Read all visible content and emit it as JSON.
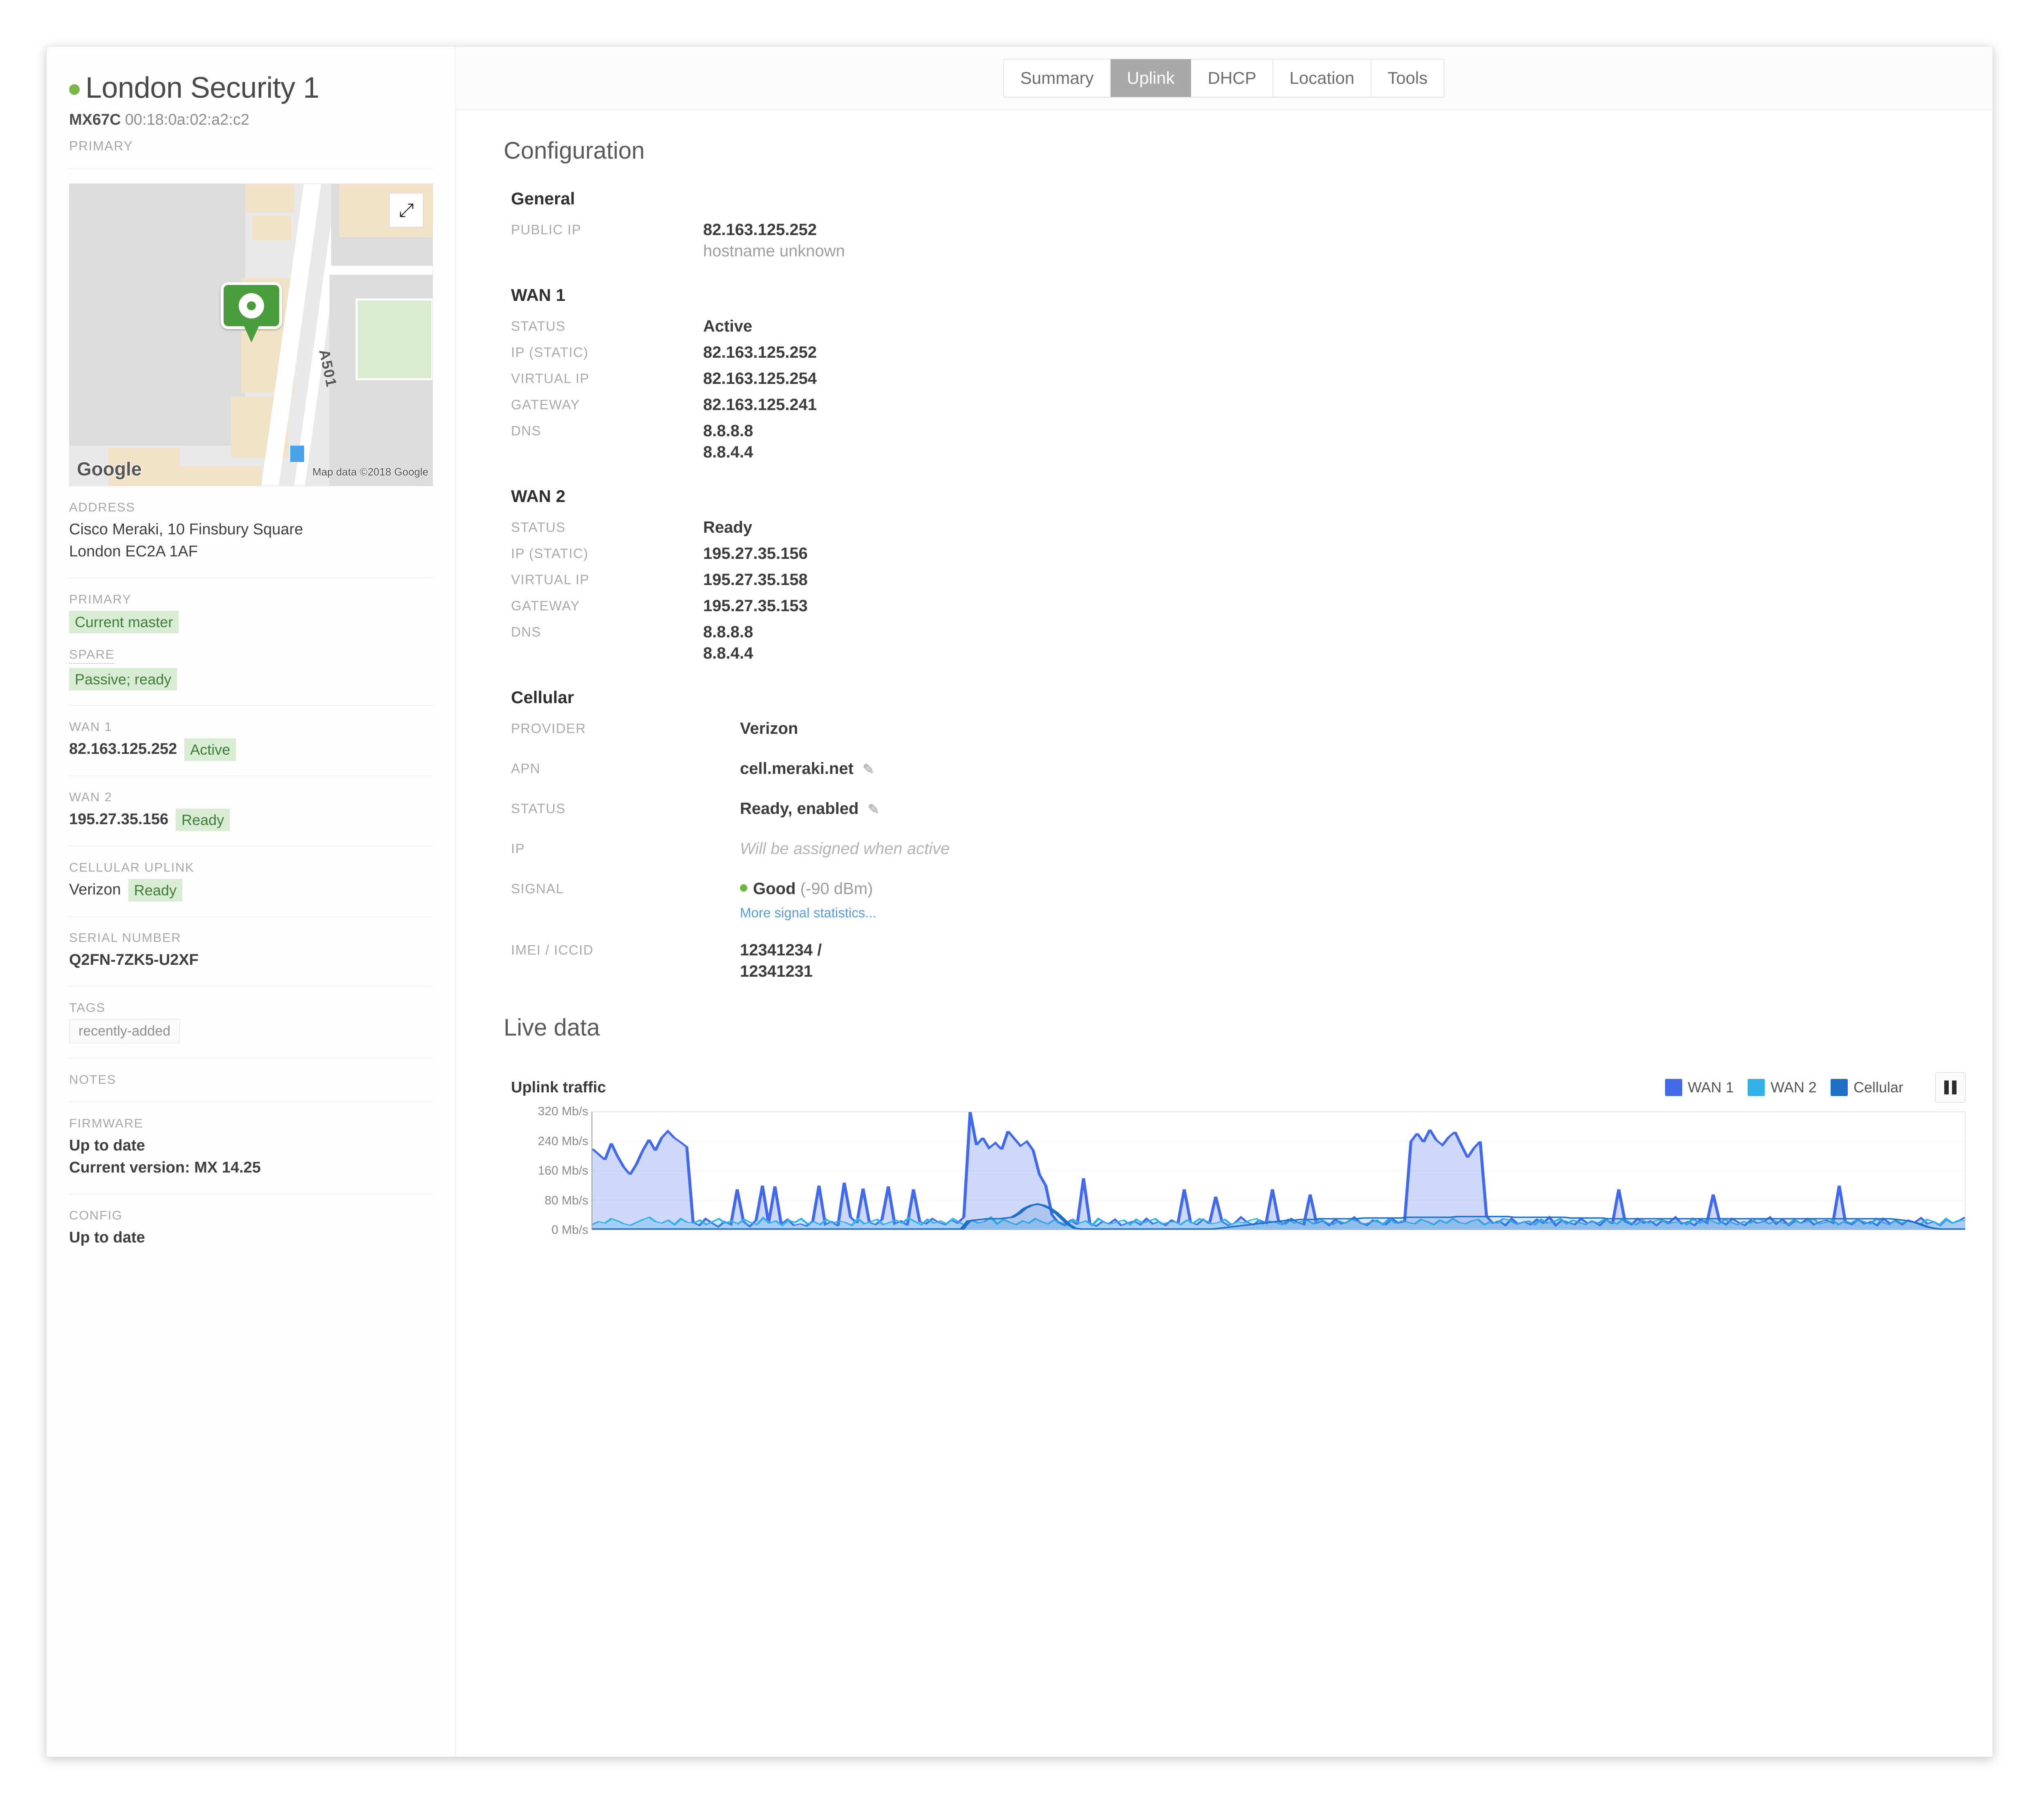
{
  "device": {
    "name": "London Security 1",
    "status_color": "#7ab648",
    "model": "MX67C",
    "mac": "00:18:0a:02:a2:c2",
    "role_label": "PRIMARY"
  },
  "map": {
    "road_label": "A501",
    "logo": "Google",
    "attribution": "Map data ©2018 Google",
    "expand_icon": "expand-icon"
  },
  "sidebar": {
    "address": {
      "label": "ADDRESS",
      "line1": "Cisco Meraki, 10 Finsbury Square",
      "line2": "London EC2A 1AF"
    },
    "primary": {
      "label": "PRIMARY",
      "badge": "Current master"
    },
    "spare": {
      "label": "SPARE",
      "badge": "Passive; ready"
    },
    "wan1": {
      "label": "WAN 1",
      "ip": "82.163.125.252",
      "badge": "Active"
    },
    "wan2": {
      "label": "WAN 2",
      "ip": "195.27.35.156",
      "badge": "Ready"
    },
    "cellular": {
      "label": "CELLULAR UPLINK",
      "provider": "Verizon",
      "badge": "Ready"
    },
    "serial": {
      "label": "SERIAL NUMBER",
      "value": "Q2FN-7ZK5-U2XF"
    },
    "tags": {
      "label": "TAGS",
      "items": [
        "recently-added"
      ]
    },
    "notes": {
      "label": "NOTES",
      "value": ""
    },
    "firmware": {
      "label": "FIRMWARE",
      "status": "Up to date",
      "version": "Current version: MX 14.25"
    },
    "config": {
      "label": "CONFIG",
      "status": "Up to date"
    }
  },
  "tabs": [
    {
      "label": "Summary",
      "active": false
    },
    {
      "label": "Uplink",
      "active": true
    },
    {
      "label": "DHCP",
      "active": false
    },
    {
      "label": "Location",
      "active": false
    },
    {
      "label": "Tools",
      "active": false
    }
  ],
  "main": {
    "configuration_title": "Configuration",
    "general": {
      "heading": "General",
      "public_ip_label": "PUBLIC IP",
      "public_ip": "82.163.125.252",
      "hostname": "hostname unknown"
    },
    "wan1": {
      "heading": "WAN 1",
      "status_label": "STATUS",
      "status": "Active",
      "ip_label": "IP (STATIC)",
      "ip": "82.163.125.252",
      "virtual_ip_label": "VIRTUAL IP",
      "virtual_ip": "82.163.125.254",
      "gateway_label": "GATEWAY",
      "gateway": "82.163.125.241",
      "dns_label": "DNS",
      "dns1": "8.8.8.8",
      "dns2": "8.8.4.4"
    },
    "wan2": {
      "heading": "WAN 2",
      "status_label": "STATUS",
      "status": "Ready",
      "ip_label": "IP (STATIC)",
      "ip": "195.27.35.156",
      "virtual_ip_label": "VIRTUAL IP",
      "virtual_ip": "195.27.35.158",
      "gateway_label": "GATEWAY",
      "gateway": "195.27.35.153",
      "dns_label": "DNS",
      "dns1": "8.8.8.8",
      "dns2": "8.8.4.4"
    },
    "cellular": {
      "heading": "Cellular",
      "provider_label": "PROVIDER",
      "provider": "Verizon",
      "apn_label": "APN",
      "apn": "cell.meraki.net",
      "status_label": "STATUS",
      "status": "Ready, enabled",
      "ip_label": "IP",
      "ip": "Will be assigned when active",
      "signal_label": "SIGNAL",
      "signal_quality": "Good",
      "signal_value": "(-90 dBm)",
      "signal_link": "More signal statistics...",
      "imei_label": "IMEI / ICCID",
      "imei": "12341234 /",
      "iccid": "12341231"
    },
    "live_data_title": "Live data"
  },
  "chart_data": {
    "type": "area",
    "title": "Uplink traffic",
    "xlabel": "",
    "ylabel": "",
    "ylim": [
      0,
      320
    ],
    "yticks": [
      320,
      240,
      160,
      80,
      0
    ],
    "ytick_labels": [
      "320 Mb/s",
      "240 Mb/s",
      "160 Mb/s",
      "80 Mb/s",
      "0 Mb/s"
    ],
    "grid": true,
    "legend_position": "top-right",
    "colors": {
      "wan1": "#4169e8",
      "wan2": "#35b0e8",
      "cellular": "#1f6fc4"
    },
    "series": [
      {
        "name": "WAN 1",
        "color": "#4169e8",
        "values": [
          220,
          205,
          190,
          235,
          200,
          170,
          150,
          178,
          215,
          245,
          215,
          250,
          268,
          250,
          238,
          225,
          20,
          12,
          30,
          18,
          8,
          22,
          14,
          110,
          22,
          9,
          26,
          120,
          18,
          118,
          15,
          28,
          12,
          16,
          10,
          24,
          120,
          14,
          22,
          10,
          128,
          34,
          18,
          112,
          20,
          14,
          28,
          118,
          16,
          24,
          12,
          110,
          22,
          16,
          30,
          20,
          14,
          26,
          18,
          34,
          320,
          230,
          250,
          222,
          236,
          218,
          268,
          248,
          228,
          240,
          216,
          150,
          120,
          40,
          20,
          12,
          26,
          14,
          140,
          18,
          10,
          22,
          16,
          28,
          12,
          18,
          24,
          14,
          30,
          16,
          22,
          12,
          26,
          18,
          110,
          20,
          14,
          28,
          16,
          90,
          22,
          12,
          18,
          34,
          20,
          14,
          26,
          18,
          110,
          22,
          16,
          30,
          20,
          14,
          96,
          18,
          24,
          12,
          28,
          16,
          22,
          34,
          18,
          12,
          26,
          20,
          14,
          30,
          18,
          22,
          240,
          262,
          238,
          272,
          244,
          230,
          252,
          266,
          230,
          196,
          222,
          240,
          36,
          18,
          24,
          12,
          30,
          16,
          22,
          14,
          28,
          18,
          34,
          12,
          26,
          20,
          14,
          30,
          18,
          22,
          12,
          28,
          16,
          110,
          22,
          14,
          30,
          18,
          24,
          12,
          26,
          20,
          34,
          16,
          22,
          12,
          28,
          18,
          96,
          24,
          14,
          30,
          20,
          12,
          26,
          18,
          22,
          34,
          16,
          28,
          12,
          24,
          18,
          30,
          14,
          22,
          26,
          18,
          120,
          20,
          14,
          28,
          16,
          22,
          12,
          30,
          18,
          24,
          14,
          26,
          20,
          32,
          16,
          22,
          12,
          28,
          18,
          24,
          34
        ]
      },
      {
        "name": "WAN 2",
        "color": "#35b0e8",
        "values": [
          14,
          22,
          18,
          30,
          24,
          16,
          12,
          20,
          28,
          34,
          22,
          18,
          26,
          14,
          30,
          20,
          18,
          26,
          14,
          22,
          30,
          18,
          24,
          16,
          28,
          20,
          14,
          32,
          18,
          24,
          12,
          26,
          20,
          30,
          16,
          22,
          14,
          28,
          18,
          24,
          20,
          12,
          30,
          16,
          22,
          28,
          14,
          20,
          26,
          18,
          32,
          22,
          14,
          28,
          18,
          24,
          16,
          30,
          20,
          12,
          26,
          18,
          22,
          34,
          16,
          28,
          20,
          14,
          24,
          18,
          30,
          22,
          16,
          26,
          20,
          14,
          28,
          18,
          24,
          12,
          30,
          20,
          16,
          22,
          26,
          14,
          28,
          18,
          24,
          30,
          16,
          20,
          22,
          14,
          26,
          18,
          30,
          24,
          16,
          20,
          28,
          14,
          22,
          18,
          26,
          30,
          16,
          24,
          20,
          14,
          28,
          18,
          22,
          26,
          16,
          30,
          20,
          14,
          24,
          18,
          28,
          22,
          16,
          20,
          26,
          14,
          30,
          18,
          24,
          20,
          16,
          28,
          22,
          14,
          26,
          18,
          30,
          20,
          16,
          24,
          28,
          14,
          22,
          18,
          30,
          26,
          16,
          20,
          24,
          14,
          28,
          18,
          22,
          30,
          16,
          26,
          20,
          14,
          24,
          18,
          28,
          22,
          16,
          30,
          20,
          14,
          26,
          18,
          24,
          28,
          16,
          20,
          22,
          14,
          30,
          18,
          26,
          24,
          16,
          28,
          20,
          14,
          22,
          18,
          30,
          26,
          16,
          24,
          20,
          14,
          28,
          18,
          22,
          30,
          16,
          20,
          26,
          14,
          24,
          18,
          28,
          22,
          16,
          30,
          20,
          14,
          26,
          18,
          24,
          20,
          16,
          28,
          22,
          14,
          30,
          18,
          26,
          24
        ]
      },
      {
        "name": "Cellular",
        "color": "#1f6fc4",
        "values": [
          2,
          2,
          2,
          2,
          2,
          2,
          2,
          2,
          2,
          2,
          2,
          2,
          2,
          2,
          2,
          2,
          2,
          2,
          2,
          2,
          2,
          2,
          2,
          2,
          2,
          2,
          2,
          2,
          2,
          2,
          2,
          2,
          2,
          2,
          2,
          2,
          2,
          2,
          2,
          2,
          2,
          2,
          2,
          2,
          2,
          2,
          2,
          2,
          2,
          2,
          2,
          2,
          2,
          2,
          2,
          2,
          2,
          2,
          2,
          2,
          24,
          26,
          28,
          30,
          30,
          30,
          32,
          34,
          44,
          58,
          66,
          70,
          66,
          58,
          46,
          30,
          14,
          4,
          2,
          2,
          2,
          2,
          2,
          2,
          2,
          2,
          2,
          2,
          2,
          2,
          2,
          2,
          2,
          2,
          2,
          2,
          2,
          2,
          2,
          2,
          4,
          6,
          8,
          10,
          12,
          14,
          16,
          18,
          20,
          22,
          24,
          26,
          26,
          28,
          28,
          28,
          30,
          30,
          30,
          30,
          30,
          30,
          30,
          32,
          32,
          32,
          32,
          32,
          32,
          32,
          34,
          34,
          34,
          34,
          34,
          34,
          34,
          34,
          36,
          36,
          36,
          36,
          36,
          36,
          36,
          36,
          36,
          34,
          34,
          34,
          34,
          34,
          34,
          34,
          34,
          34,
          32,
          32,
          32,
          32,
          32,
          32,
          30,
          30,
          30,
          30,
          30,
          30,
          30,
          30,
          30,
          30,
          30,
          30,
          30,
          30,
          30,
          30,
          30,
          30,
          30,
          30,
          30,
          30,
          30,
          30,
          30,
          30,
          30,
          30,
          30,
          30,
          30,
          30,
          30,
          30,
          30,
          30,
          30,
          30,
          30,
          30,
          30,
          30,
          30,
          30,
          30,
          30,
          28,
          26,
          24,
          20,
          14,
          8,
          4,
          2,
          2,
          2,
          2,
          2
        ]
      }
    ]
  }
}
